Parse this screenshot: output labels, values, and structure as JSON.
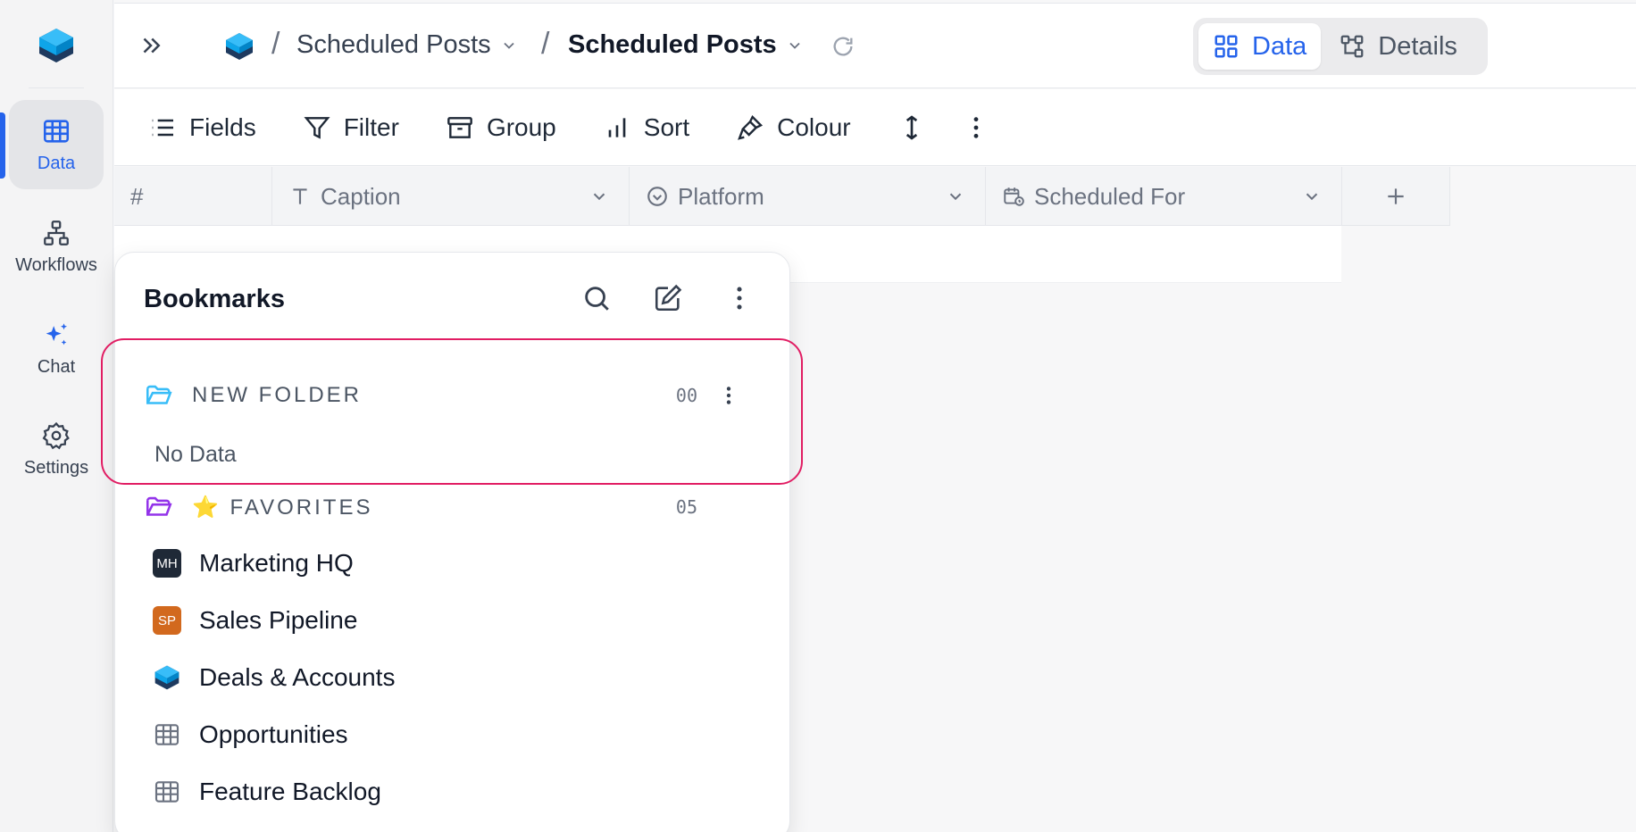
{
  "rail": {
    "items": [
      {
        "label": "Data",
        "icon": "table-icon",
        "active": true
      },
      {
        "label": "Workflows",
        "icon": "workflow-icon",
        "active": false
      },
      {
        "label": "Chat",
        "icon": "sparkle-icon",
        "active": false
      },
      {
        "label": "Settings",
        "icon": "gear-icon",
        "active": false
      }
    ]
  },
  "header": {
    "breadcrumb_parent": "Scheduled Posts",
    "breadcrumb_current": "Scheduled Posts",
    "view_data_label": "Data",
    "view_details_label": "Details"
  },
  "toolbar": {
    "fields_label": "Fields",
    "filter_label": "Filter",
    "group_label": "Group",
    "sort_label": "Sort",
    "colour_label": "Colour"
  },
  "grid": {
    "row_number_header": "#",
    "columns": [
      {
        "label": "Caption",
        "icon": "text-type-icon"
      },
      {
        "label": "Platform",
        "icon": "select-circle-icon"
      },
      {
        "label": "Scheduled For",
        "icon": "calendar-clock-icon"
      }
    ]
  },
  "bookmarks": {
    "title": "Bookmarks",
    "folders": [
      {
        "name": "NEW FOLDER",
        "count": "00",
        "empty_text": "No Data",
        "color": "#38bdf8"
      },
      {
        "name": "⭐ FAVORITES",
        "count": "05",
        "color": "#9333ea"
      }
    ],
    "items": [
      {
        "label": "Marketing HQ",
        "avatar": "MH",
        "avatar_color": "#1f2937"
      },
      {
        "label": "Sales Pipeline",
        "avatar": "SP",
        "avatar_color": "#d2691e"
      },
      {
        "label": "Deals & Accounts",
        "icon": "cube-icon"
      },
      {
        "label": "Opportunities",
        "icon": "table-icon"
      },
      {
        "label": "Feature Backlog",
        "icon": "table-icon"
      }
    ]
  },
  "colors": {
    "accent": "#2563eb",
    "highlight_border": "#e11d63"
  }
}
